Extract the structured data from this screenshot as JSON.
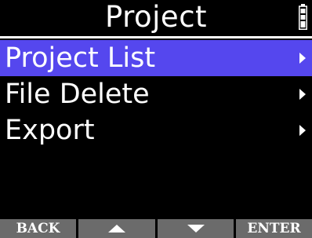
{
  "header": {
    "title": "Project",
    "battery_icon": "battery-icon"
  },
  "menu": {
    "items": [
      {
        "label": "Project List",
        "selected": true,
        "icon": "chevron-right-icon"
      },
      {
        "label": "File Delete",
        "selected": false,
        "icon": "chevron-right-icon"
      },
      {
        "label": "Export",
        "selected": false,
        "icon": "chevron-right-icon"
      }
    ]
  },
  "footer": {
    "keys": [
      {
        "label": "BACK"
      },
      {
        "label": "",
        "icon": "arrow-up-icon"
      },
      {
        "label": "",
        "icon": "arrow-down-icon"
      },
      {
        "label": "ENTER"
      }
    ]
  },
  "colors": {
    "background": "#000000",
    "selection": "#5547ee",
    "softkey": "#6b6b6b",
    "text": "#ffffff"
  }
}
